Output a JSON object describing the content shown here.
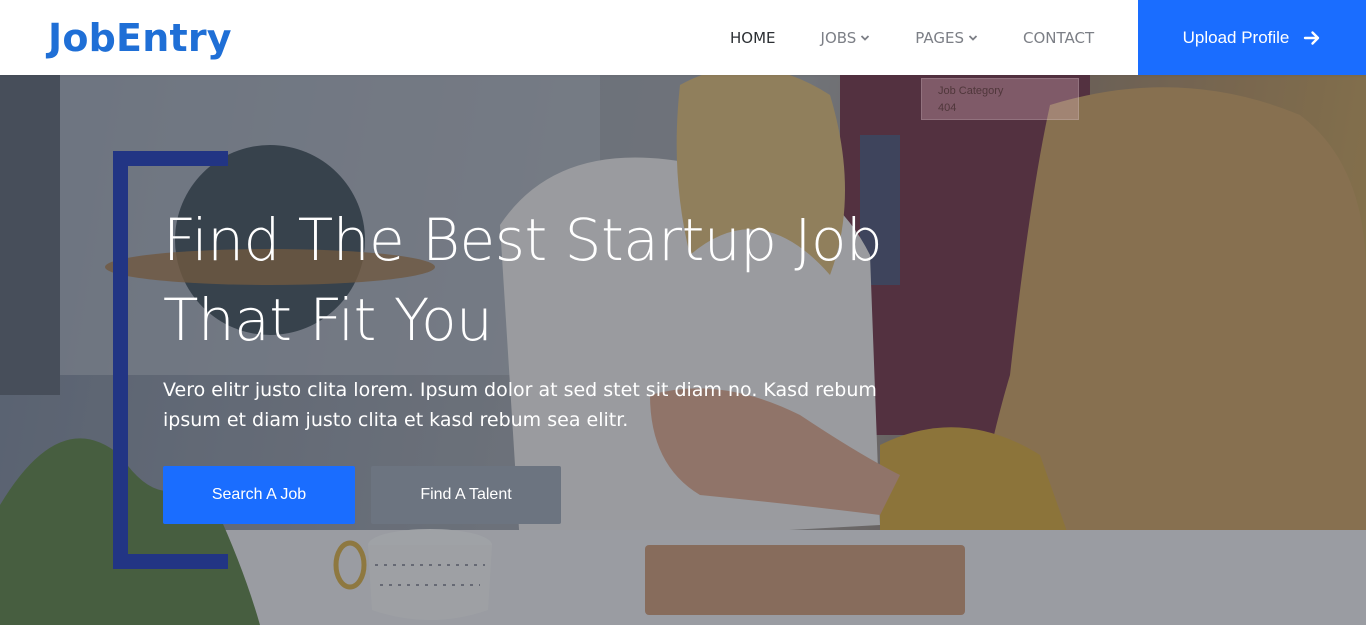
{
  "brand": "JobEntry",
  "nav": {
    "items": [
      {
        "label": "HOME",
        "active": true,
        "dropdown": false
      },
      {
        "label": "JOBS",
        "active": false,
        "dropdown": true
      },
      {
        "label": "PAGES",
        "active": false,
        "dropdown": true
      },
      {
        "label": "CONTACT",
        "active": false,
        "dropdown": false
      }
    ],
    "cta_label": "Upload Profile",
    "cta_icon": "arrow-right-icon"
  },
  "hero": {
    "title_line1": "Find The Best Startup Job",
    "title_line2": "That Fit You",
    "description": "Vero elitr justo clita lorem. Ipsum dolor at sed stet sit diam no. Kasd rebum ipsum et diam justo clita et kasd rebum sea elitr.",
    "primary_button": "Search A Job",
    "secondary_button": "Find A Talent",
    "sign_line1": "Job Category",
    "sign_line2": "404"
  },
  "colors": {
    "brand": "#1f6fd6",
    "primary": "#1a6dff",
    "secondary": "#6c7480",
    "bracket": "#223584"
  }
}
